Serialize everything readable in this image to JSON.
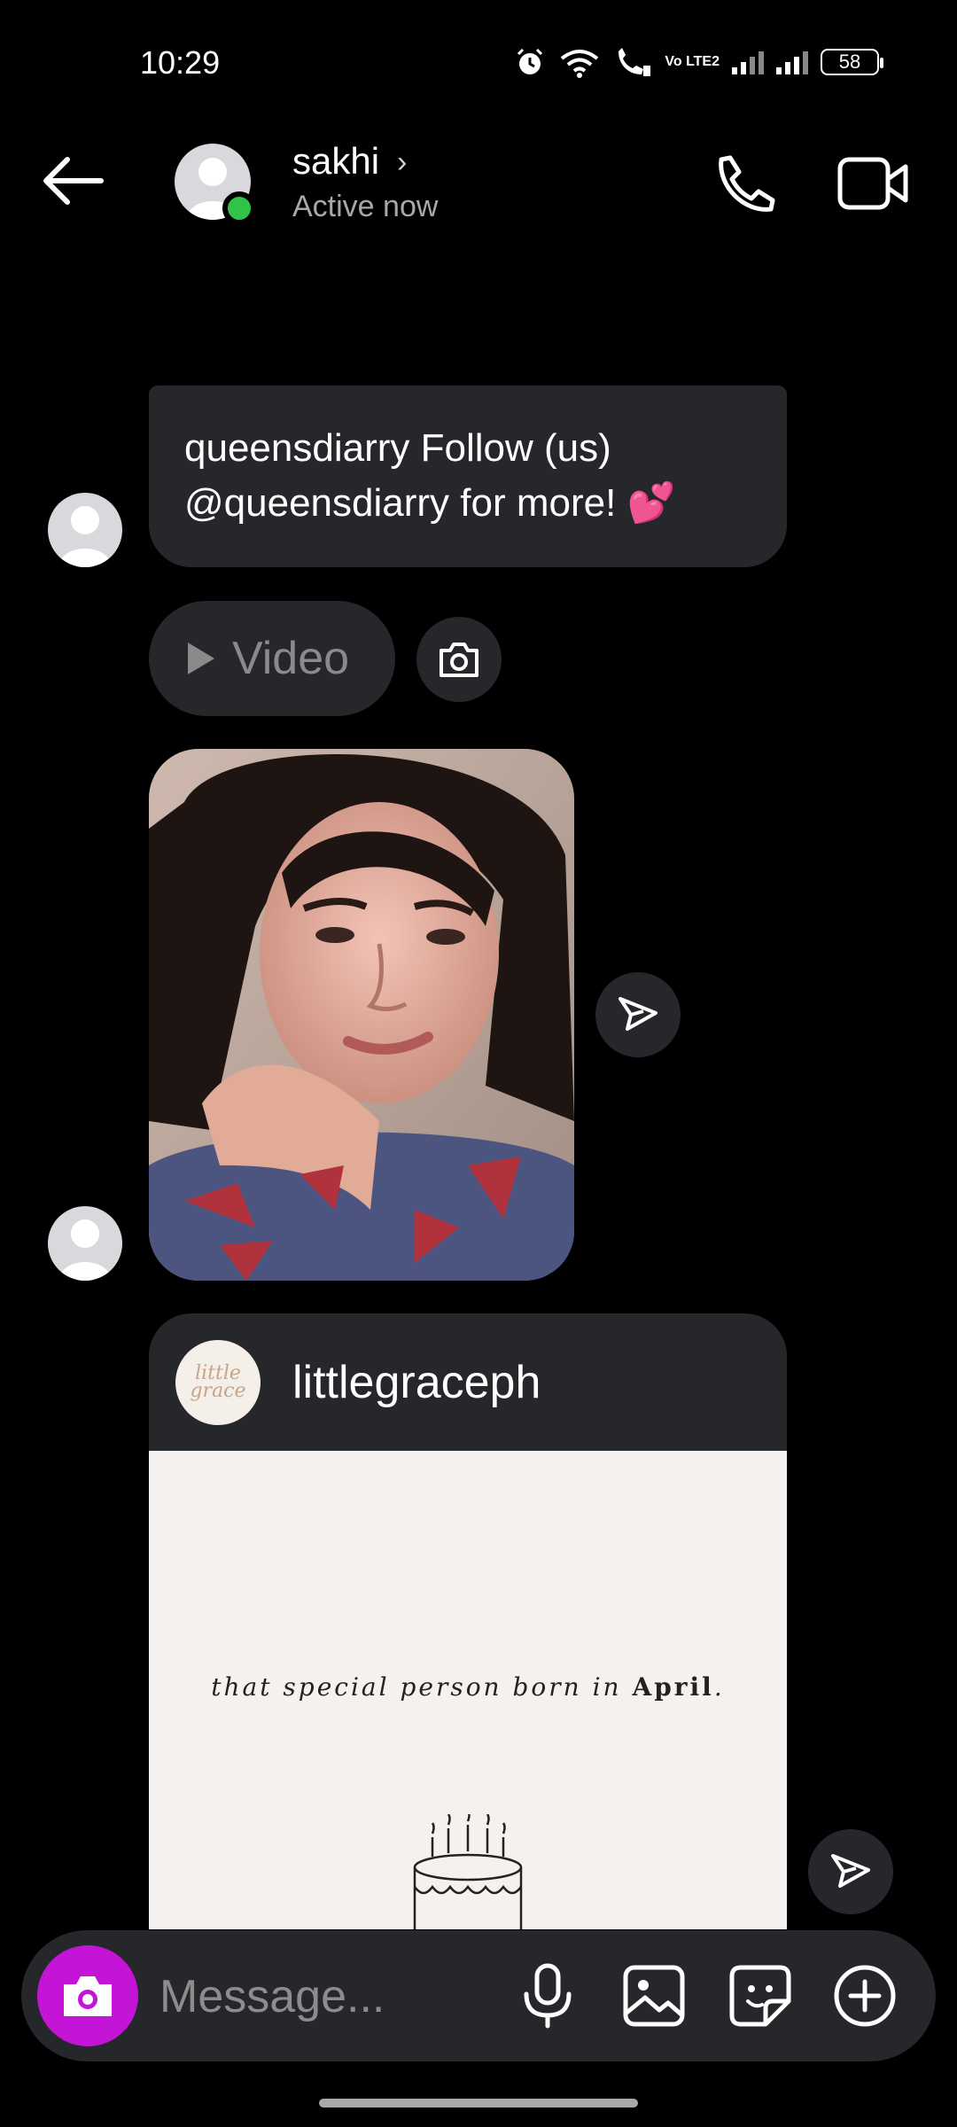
{
  "status_bar": {
    "time": "10:29",
    "battery": "58",
    "network_label": "Vo LTE2",
    "icons": [
      "alarm-icon",
      "wifi-icon",
      "wifi-call-icon",
      "volte-icon",
      "signal-icon",
      "signal-icon",
      "battery-icon"
    ]
  },
  "header": {
    "name": "sakhi",
    "chevron": "›",
    "status": "Active now",
    "online_color": "#31c24a"
  },
  "messages": {
    "text_message": {
      "line1": "queensdiarry Follow (us)",
      "line2": "@queensdiarry for more!",
      "emoji": "💕"
    },
    "video_label": "Video",
    "post": {
      "username": "littlegraceph",
      "logo_text": "little grace",
      "caption_part1": "that special person born in ",
      "caption_bold": "April",
      "caption_end": "."
    }
  },
  "composer": {
    "placeholder": "Message...",
    "accent_color": "#c414d6"
  }
}
